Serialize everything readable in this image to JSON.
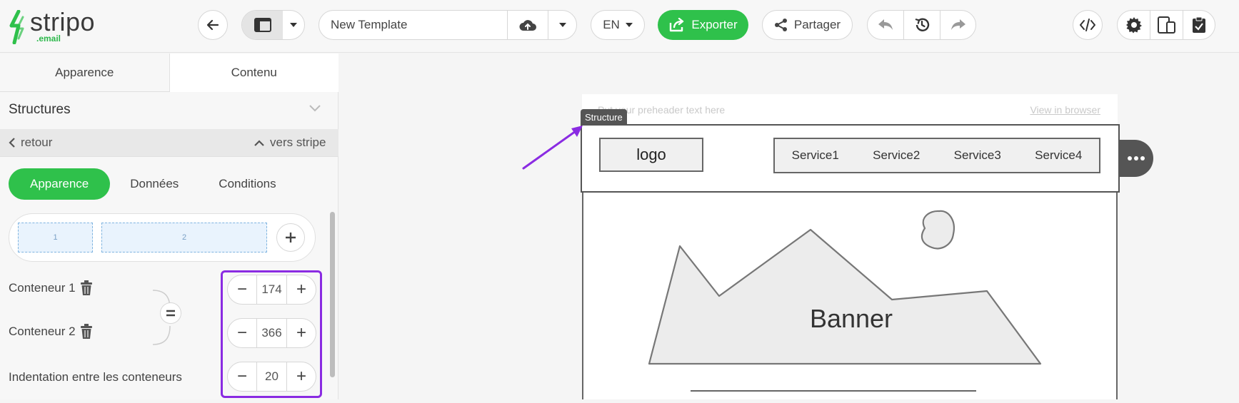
{
  "brand": {
    "name": "stripo",
    "sub": ".email",
    "accent": "#2fc14b"
  },
  "toolbar": {
    "template_name": "New Template",
    "language": "EN",
    "export_label": "Exporter",
    "share_label": "Partager"
  },
  "sidebar": {
    "tabs": [
      {
        "label": "Apparence"
      },
      {
        "label": "Contenu"
      }
    ],
    "section_title": "Structures",
    "back_label": "retour",
    "up_label": "vers stripe",
    "segments": [
      {
        "label": "Apparence"
      },
      {
        "label": "Données"
      },
      {
        "label": "Conditions"
      }
    ],
    "columns": [
      {
        "label": "1"
      },
      {
        "label": "2"
      }
    ],
    "container1_label": "Conteneur 1",
    "container2_label": "Conteneur 2",
    "indent_label": "Indentation entre les conteneurs",
    "container1_value": "174",
    "container2_value": "366",
    "indent_value": "20"
  },
  "email": {
    "preheader": "Put your preheader text here",
    "view_in_browser": "View in browser",
    "structure_tag": "Structure",
    "logo": "logo",
    "menu": [
      {
        "label": "Service1"
      },
      {
        "label": "Service2"
      },
      {
        "label": "Service3"
      },
      {
        "label": "Service4"
      }
    ],
    "banner_label": "Banner"
  },
  "icons": {
    "back": "arrow-left-icon",
    "layout": "layout-icon",
    "upload": "cloud-upload-icon",
    "share": "share-icon",
    "undo": "undo-icon",
    "history": "history-icon",
    "redo": "redo-icon",
    "code": "code-icon",
    "settings": "gear-icon",
    "mobile": "mobile-preview-icon",
    "clipboard": "clipboard-check-icon"
  }
}
